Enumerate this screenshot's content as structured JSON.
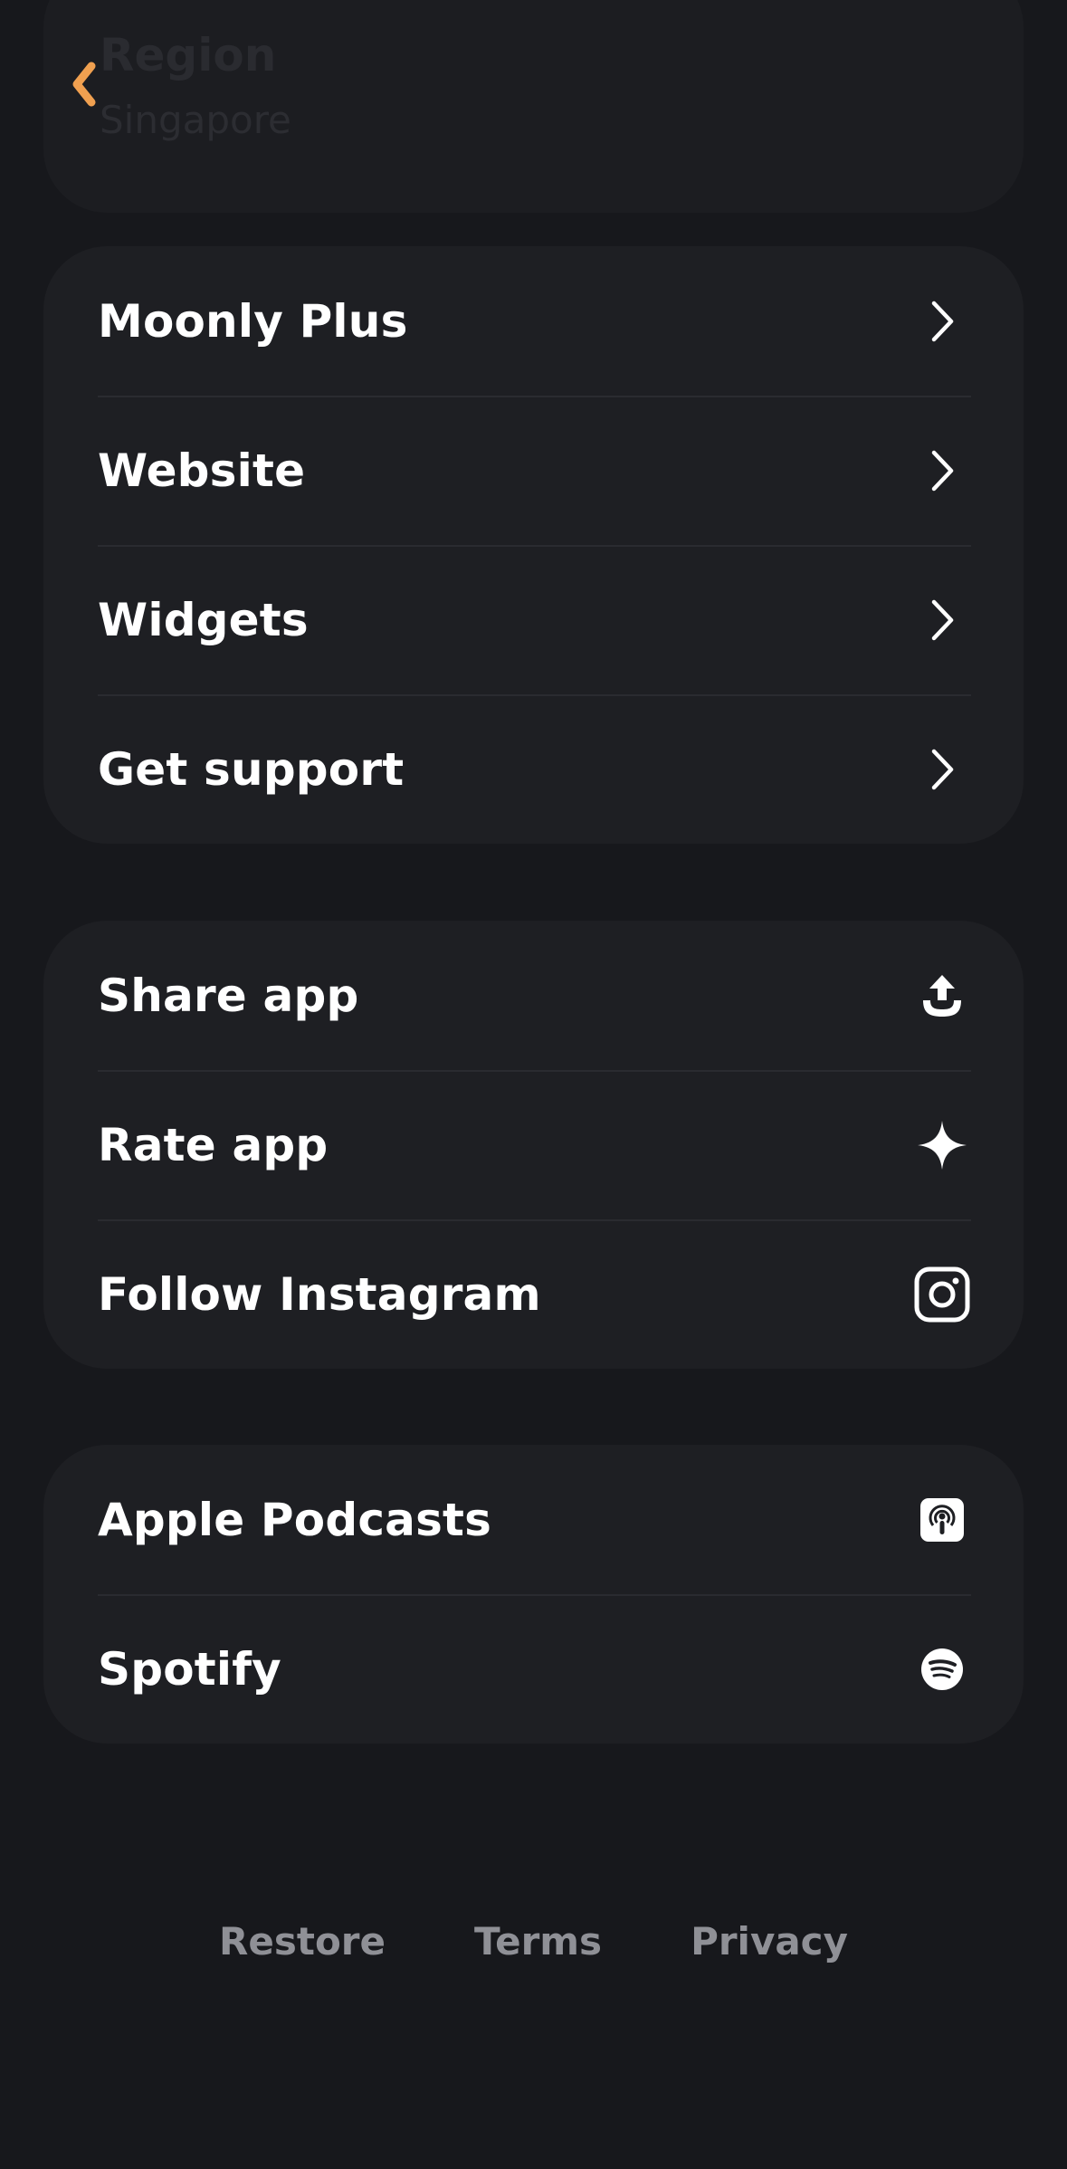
{
  "header": {
    "back_icon": "chevron-left-icon",
    "accent_color": "#f0a050",
    "region_title": "Region",
    "region_value": "Singapore"
  },
  "groups": [
    {
      "items": [
        {
          "label": "Moonly Plus",
          "icon": "chevron-right-icon"
        },
        {
          "label": "Website",
          "icon": "chevron-right-icon"
        },
        {
          "label": "Widgets",
          "icon": "chevron-right-icon"
        },
        {
          "label": "Get support",
          "icon": "chevron-right-icon"
        }
      ]
    },
    {
      "items": [
        {
          "label": "Share app",
          "icon": "share-upload-icon"
        },
        {
          "label": "Rate app",
          "icon": "sparkle-star-icon"
        },
        {
          "label": "Follow Instagram",
          "icon": "instagram-icon"
        }
      ]
    },
    {
      "items": [
        {
          "label": "Apple Podcasts",
          "icon": "apple-podcasts-icon"
        },
        {
          "label": "Spotify",
          "icon": "spotify-icon"
        }
      ]
    }
  ],
  "footer": {
    "restore": "Restore",
    "terms": "Terms",
    "privacy": "Privacy"
  }
}
